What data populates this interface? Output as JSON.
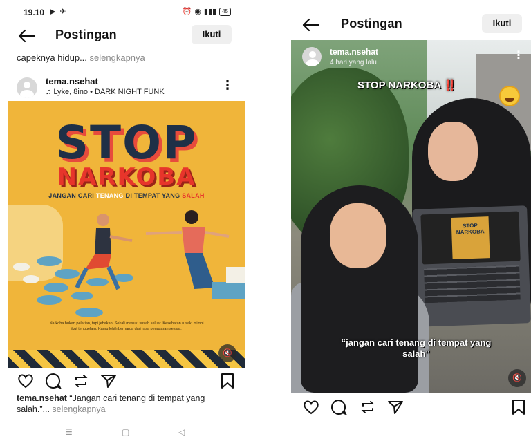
{
  "left": {
    "status": {
      "time": "19.10",
      "battery": "45"
    },
    "header": {
      "title": "Postingan",
      "follow_label": "Ikuti"
    },
    "prev_caption": {
      "text": "capeknya hidup...",
      "more": "selengkapnya"
    },
    "post": {
      "username": "tema.nsehat",
      "music": "Lyke, 8ino • DARK NIGHT FUNK",
      "poster": {
        "headline": "STOP",
        "subheadline": "NARKOBA",
        "tagline_a": "JANGAN CARI ",
        "tagline_b": "TENANG",
        "tagline_c": " DI TEMPAT YANG ",
        "tagline_d": "SALAH",
        "body_text": "Narkoba bukan pelarian, tapi jebakan. Sekali masuk, susah keluar. Kesehatan rusak, mimpi ikut tenggelam. Kamu lebih berharga dari rasa penasaran sesaat."
      },
      "caption_user": "tema.nsehat",
      "caption_text": " “Jangan cari tenang di tempat yang salah.”...",
      "caption_more": " selengkapnya"
    }
  },
  "right": {
    "header": {
      "title": "Postingan",
      "follow_label": "Ikuti"
    },
    "video": {
      "username": "tema.nsehat",
      "time_ago": "4 hari yang lalu",
      "overlay_title": "STOP NARKOBA",
      "overlay_emphasis": "‼️",
      "laptop_text": "STOP NARKOBA",
      "quote": "“jangan cari tenang di tempat yang salah”"
    }
  },
  "icons": [
    "back-arrow-icon",
    "heart-icon",
    "comment-icon",
    "repost-icon",
    "share-icon",
    "bookmark-icon",
    "mute-icon",
    "more-icon",
    "music-icon"
  ]
}
